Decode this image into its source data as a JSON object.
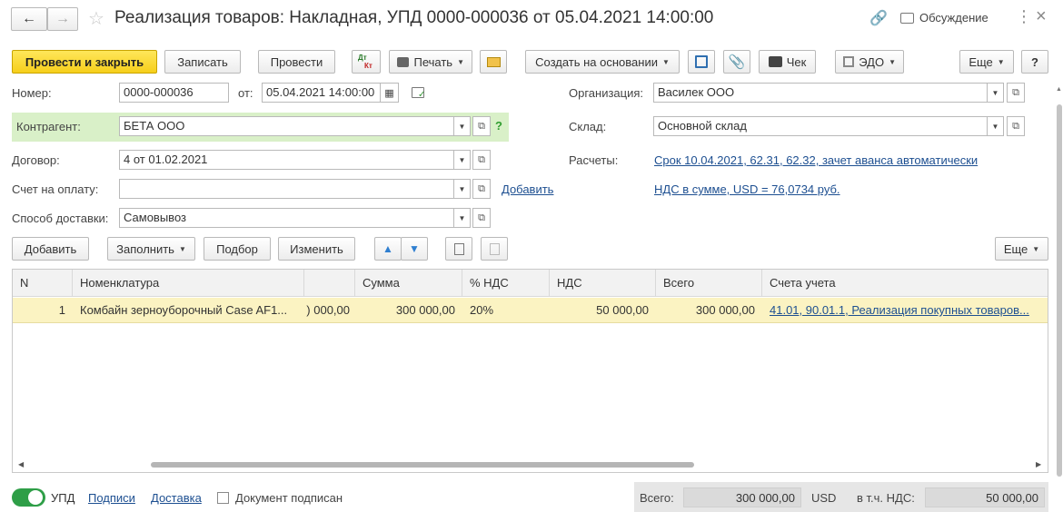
{
  "title": "Реализация товаров: Накладная, УПД 0000-000036 от 05.04.2021 14:00:00",
  "header": {
    "discussion": "Обсуждение"
  },
  "toolbar": {
    "post_close": "Провести и закрыть",
    "save": "Записать",
    "post": "Провести",
    "dtkt_top": "Дт",
    "dtkt_bottom": "Кт",
    "print": "Печать",
    "create_based": "Создать на основании",
    "check": "Чек",
    "edo": "ЭДО",
    "more": "Еще",
    "help": "?"
  },
  "form": {
    "number_label": "Номер:",
    "number_value": "0000-000036",
    "date_label": "от:",
    "date_value": "05.04.2021 14:00:00",
    "counterparty_label": "Контрагент:",
    "counterparty_value": "БЕТА ООО",
    "contract_label": "Договор:",
    "contract_value": "4 от 01.02.2021",
    "invoice_label": "Счет на оплату:",
    "invoice_value": "",
    "invoice_add": "Добавить",
    "delivery_label": "Способ доставки:",
    "delivery_value": "Самовывоз",
    "org_label": "Организация:",
    "org_value": "Василек ООО",
    "warehouse_label": "Склад:",
    "warehouse_value": "Основной склад",
    "settlements_label": "Расчеты:",
    "settlements_link": "Срок 10.04.2021, 62.31, 62.32, зачет аванса автоматически",
    "vat_link": "НДС в сумме, USD = 76,0734 руб."
  },
  "table_toolbar": {
    "add": "Добавить",
    "fill": "Заполнить",
    "select": "Подбор",
    "change": "Изменить",
    "more": "Еще"
  },
  "table": {
    "columns": [
      "N",
      "Номенклатура",
      "",
      "Сумма",
      "% НДС",
      "НДС",
      "Всего",
      "Счета учета"
    ],
    "rows": [
      {
        "n": "1",
        "item": "Комбайн зерноуборочный Case AF1...",
        "price": ") 000,00",
        "sum": "300 000,00",
        "vat_rate": "20%",
        "vat": "50 000,00",
        "total": "300 000,00",
        "accounts": "41.01, 90.01.1, Реализация покупных товаров..."
      }
    ]
  },
  "footer": {
    "upd": "УПД",
    "signatures": "Подписи",
    "delivery": "Доставка",
    "signed": "Документ подписан",
    "total_label": "Всего:",
    "total_value": "300 000,00",
    "currency": "USD",
    "vat_label": "в т.ч. НДС:",
    "vat_value": "50 000,00"
  },
  "colors": {
    "accent": "#f6cf1b",
    "selected_row": "#fbf3c2",
    "highlight_green": "#d9f0c8",
    "link": "#1d4f91"
  }
}
